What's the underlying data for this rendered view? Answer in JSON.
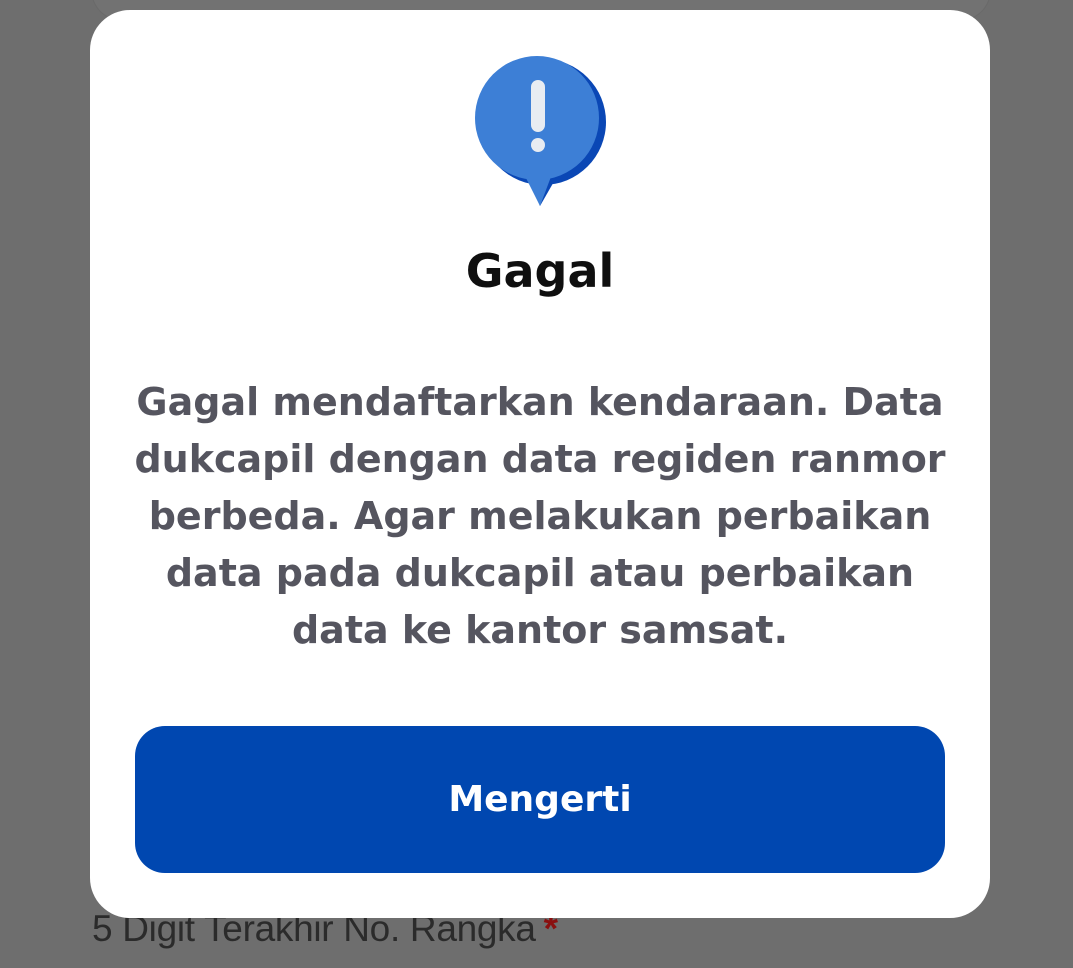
{
  "background": {
    "field_label": "5 Digit Terakhir No. Rangka",
    "required_mark": "*"
  },
  "dialog": {
    "icon": "alert-exclamation-icon",
    "title": "Gagal",
    "message": "Gagal mendaftarkan kendaraan. Data dukcapil dengan data regiden ranmor berbeda. Agar melakukan perbaikan data pada dukcapil atau perbaikan data ke kantor samsat.",
    "confirm_label": "Mengerti"
  },
  "colors": {
    "overlay": "#6e6e6e",
    "dialog_bg": "#ffffff",
    "primary": "#0047b0",
    "icon_light": "#3d7fd6",
    "icon_dark": "#0a47b5",
    "message_text": "#55555f"
  }
}
